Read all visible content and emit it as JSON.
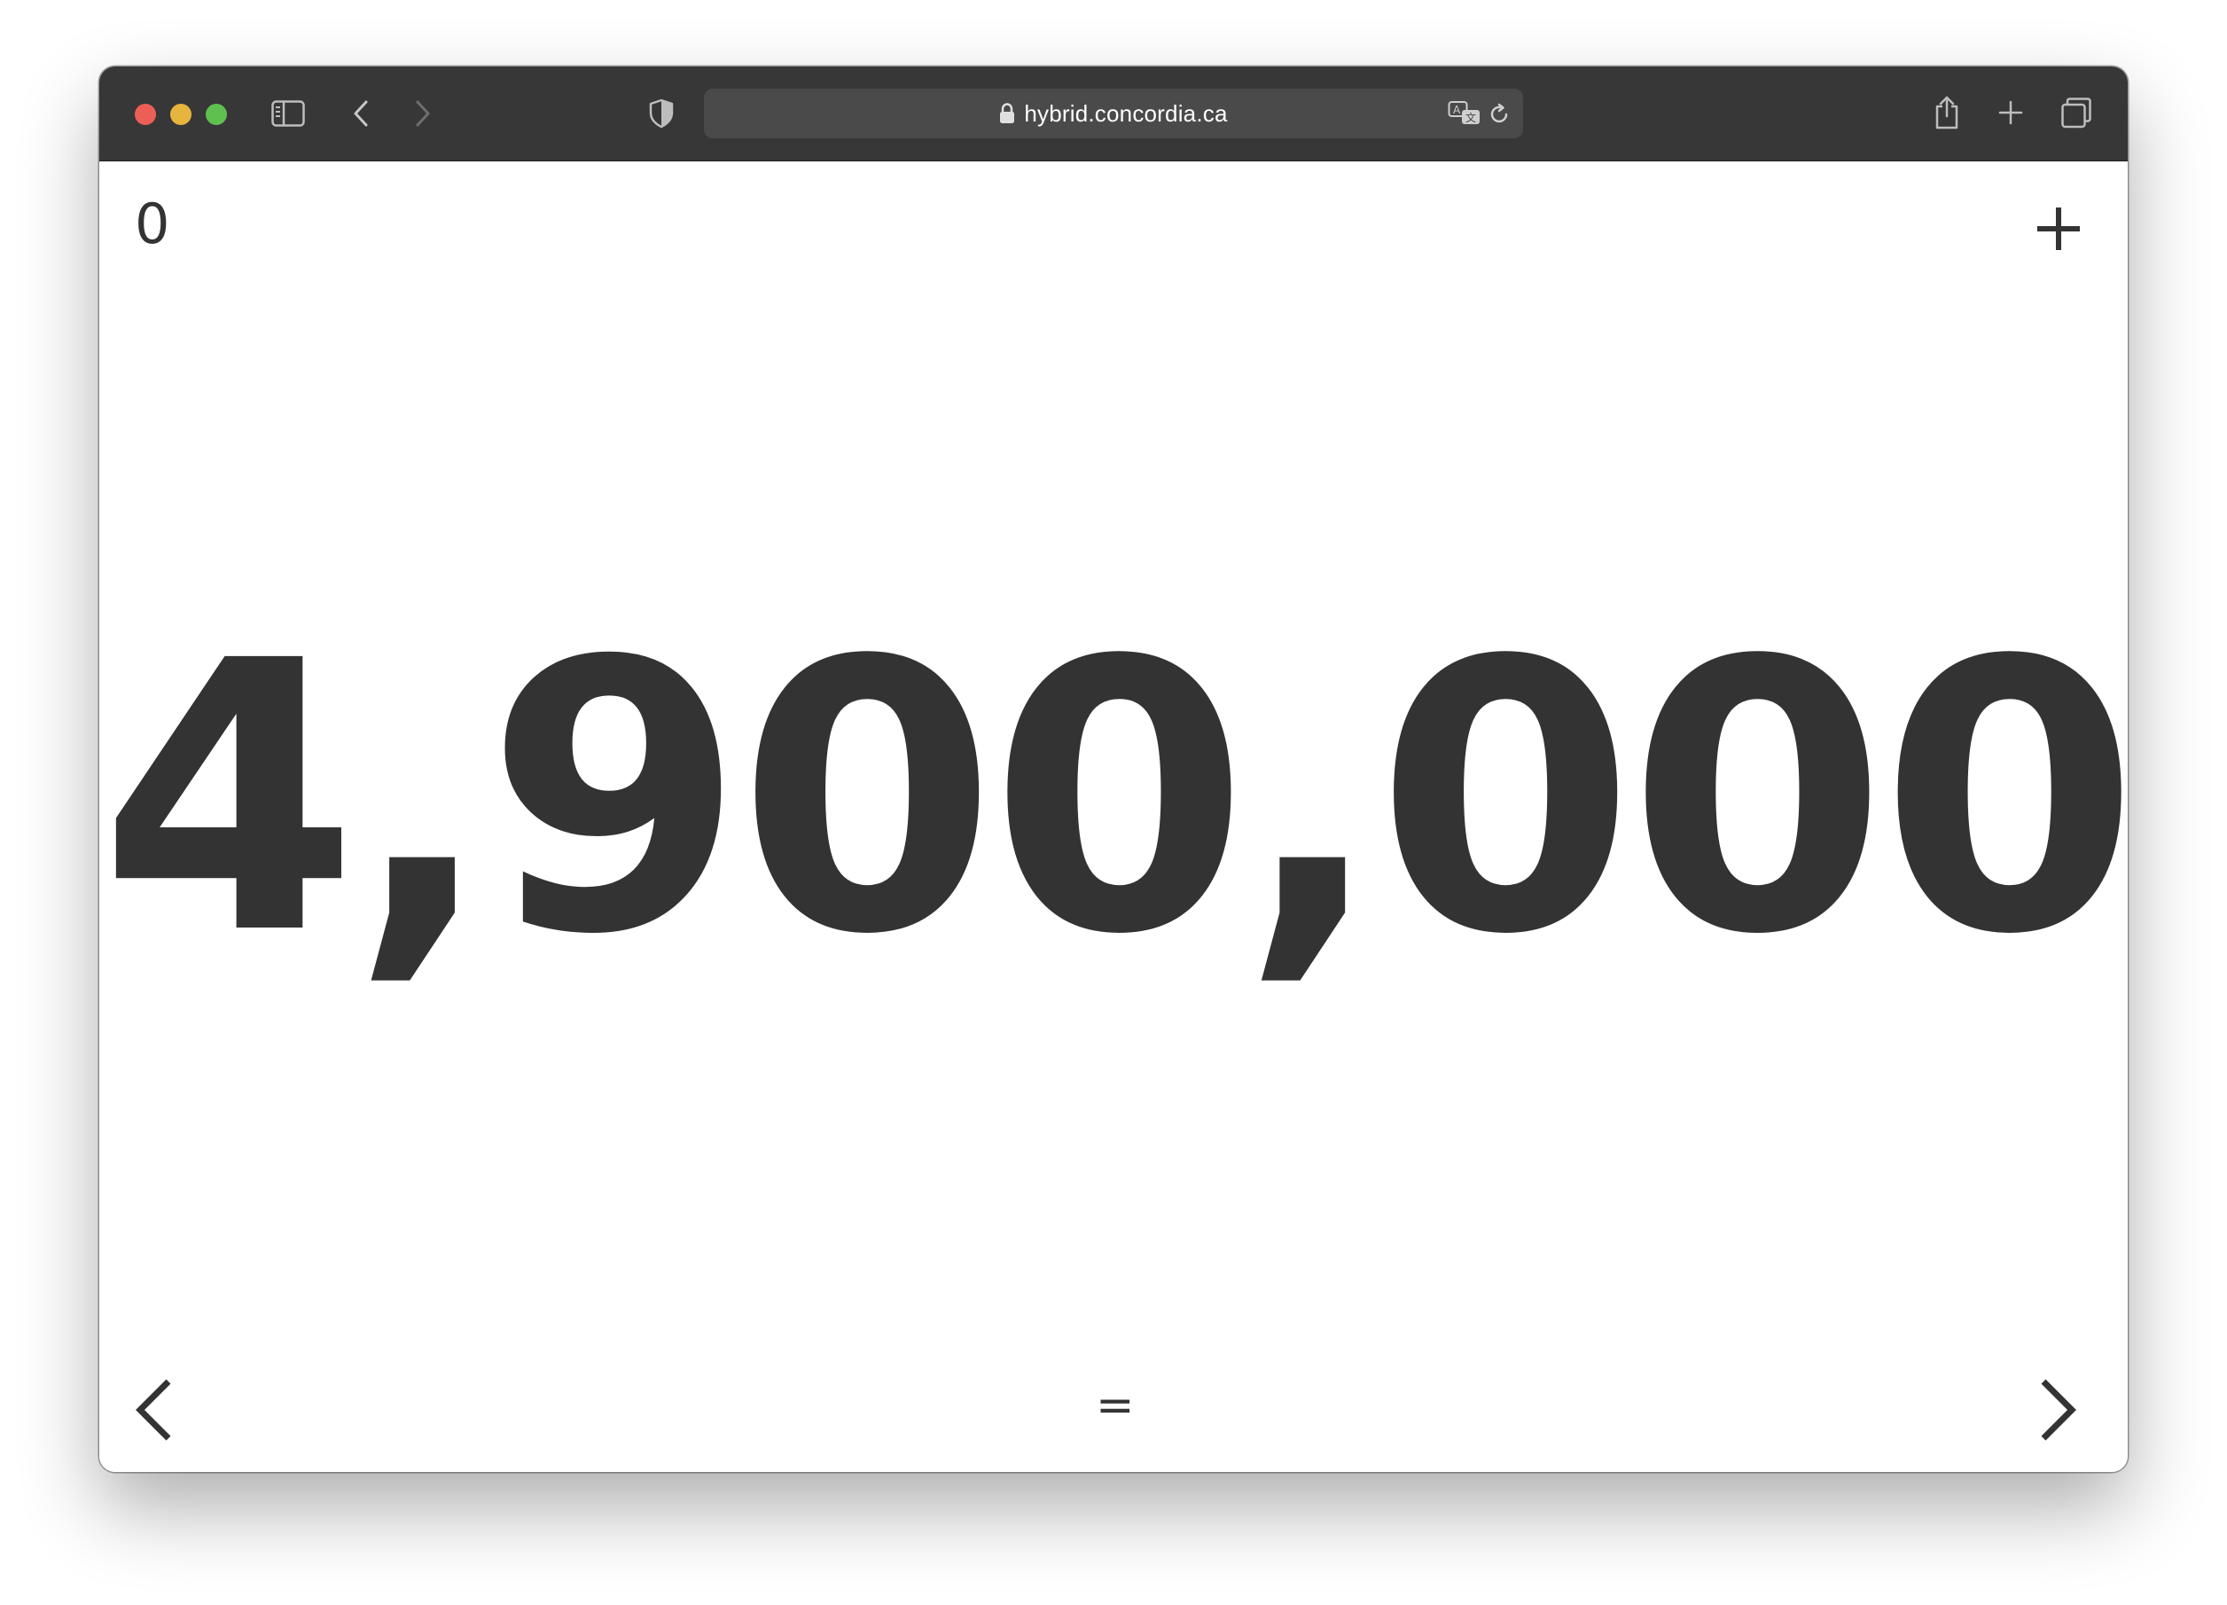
{
  "browser": {
    "url": "hybrid.concordia.ca",
    "icons": {
      "sidebar": "sidebar-toggle-icon",
      "back": "chevron-left-icon",
      "forward": "chevron-right-icon",
      "privacy": "shield-icon",
      "lock": "lock-icon",
      "translate": "translate-icon",
      "reload": "reload-icon",
      "share": "share-icon",
      "new_tab": "plus-icon",
      "tabs": "tab-overview-icon"
    },
    "colors": {
      "toolbar": "#373737",
      "address_bar": "#4a4a4a",
      "close": "#ec5f57",
      "minimize": "#e7b53d",
      "maximize": "#5fc04f"
    }
  },
  "page": {
    "counter": "0",
    "main_number": "4,900,000",
    "equals_label": "=",
    "icons": {
      "add": "plus-icon",
      "prev": "chevron-left-icon",
      "next": "chevron-right-icon"
    },
    "colors": {
      "text": "#333333",
      "background": "#ffffff"
    }
  }
}
